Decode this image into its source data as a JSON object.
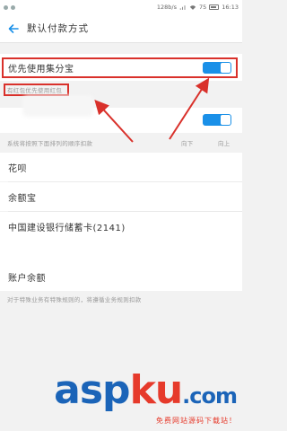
{
  "status_bar": {
    "speed": "128b/s",
    "battery": "75",
    "time": "16:13"
  },
  "header": {
    "title": "默认付款方式"
  },
  "settings": {
    "huabei_first_label": "优先使用集分宝",
    "huabei_first_on": true,
    "red_packet_hint": "有红包优先使用红包",
    "second_toggle_on": true,
    "order_hint": "系统将按照下面排列的顺序扣款",
    "move_down": "向下",
    "move_up": "向上"
  },
  "payment_methods": [
    "花呗",
    "余额宝",
    "中国建设银行储蓄卡(2141)",
    "账户余额"
  ],
  "footer_note": "对于特殊业务有特殊规则的，将遵循业务规则扣款",
  "watermark": {
    "asp": "asp",
    "ku": "ku",
    "com": ".com",
    "sub": "免费网站源码下载站！"
  },
  "colors": {
    "accent": "#1a90e8",
    "annotation": "#d9312b"
  }
}
